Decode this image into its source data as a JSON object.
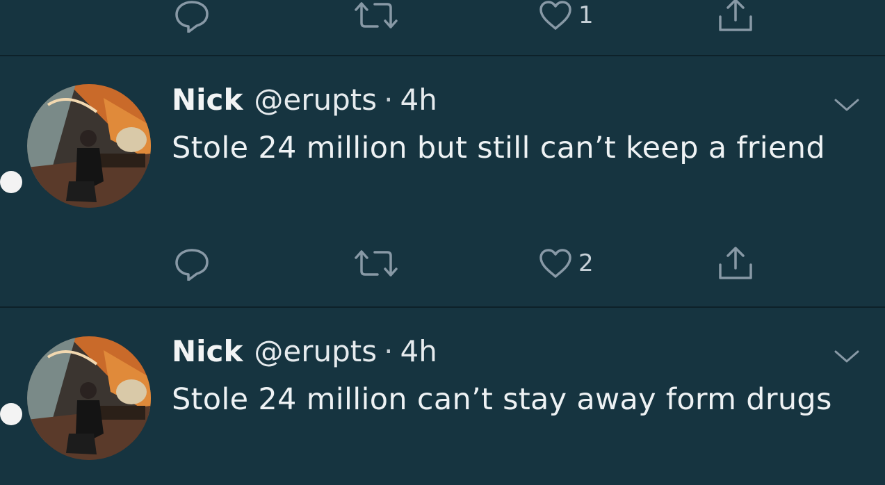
{
  "previous_tweet": {
    "like_count": "1"
  },
  "tweets": [
    {
      "name": "Nick",
      "handle": "@erupts",
      "separator": "·",
      "time": "4h",
      "text": "Stole 24 million but still can’t keep a friend",
      "like_count": "2"
    },
    {
      "name": "Nick",
      "handle": "@erupts",
      "separator": "·",
      "time": "4h",
      "text": "Stole 24 million can’t stay away form drugs"
    }
  ],
  "icons": {
    "reply": "reply-icon",
    "retweet": "retweet-icon",
    "like": "heart-icon",
    "share": "share-icon",
    "menu": "chevron-down-icon"
  },
  "colors": {
    "background": "#163440",
    "divider": "#0d2129",
    "icon": "#8899a6",
    "text": "#eef2f4"
  }
}
